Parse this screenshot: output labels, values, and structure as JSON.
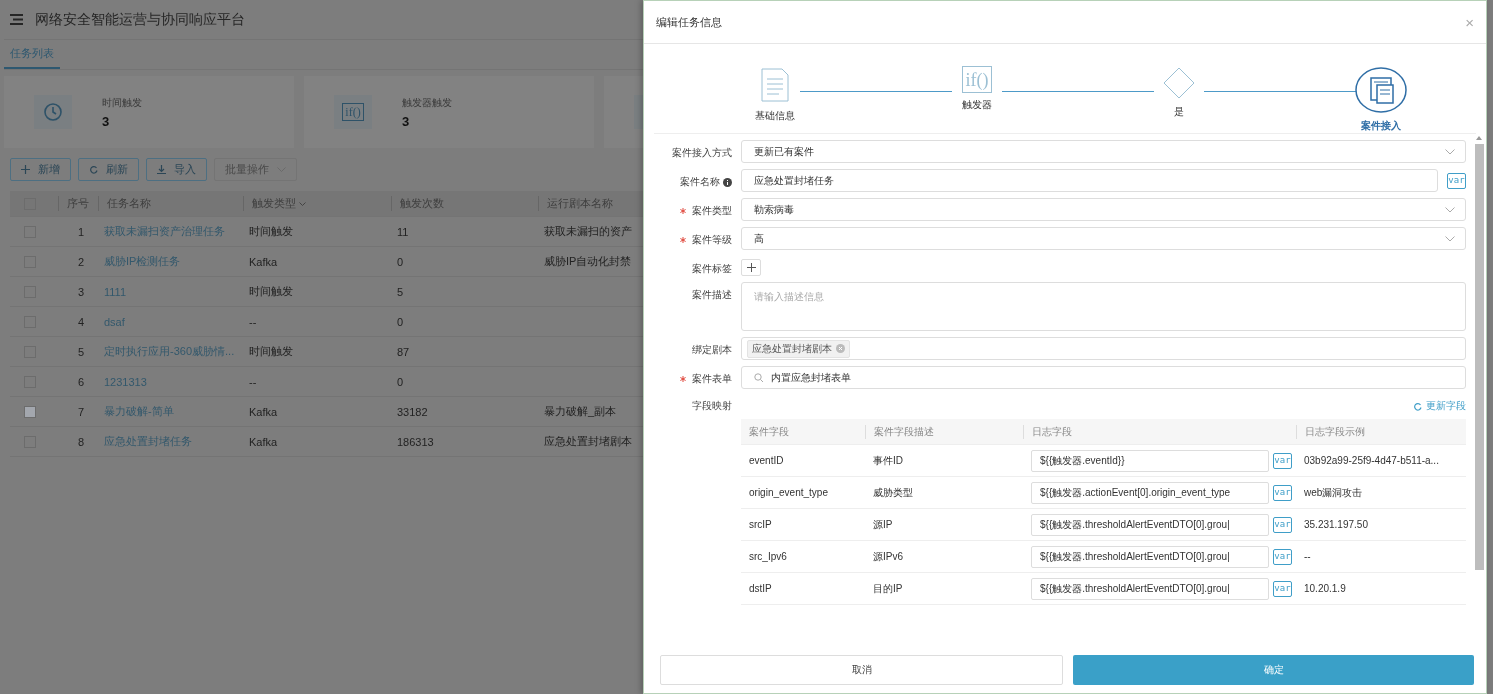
{
  "app": {
    "title": "网络安全智能运营与协同响应平台"
  },
  "tabs": [
    {
      "label": "任务列表",
      "selected": true
    }
  ],
  "stats": [
    {
      "kind": "clock",
      "label": "时间触发",
      "value": "3"
    },
    {
      "kind": "code",
      "icon_text": "if()",
      "label": "触发器触发",
      "value": "3"
    },
    {
      "kind": "partial"
    }
  ],
  "toolbar": [
    {
      "kind": "add",
      "label": "新增",
      "disabled": false
    },
    {
      "kind": "refresh",
      "label": "刷新",
      "disabled": false
    },
    {
      "kind": "import",
      "label": "导入",
      "disabled": false
    },
    {
      "kind": "batch",
      "label": "批量操作",
      "disabled": true
    }
  ],
  "table": {
    "select_all": {
      "checked": false
    },
    "columns": [
      {
        "label": "序号",
        "sortable": false
      },
      {
        "label": "任务名称",
        "sortable": false
      },
      {
        "label": "触发类型",
        "sortable": true
      },
      {
        "label": "触发次数",
        "sortable": false
      },
      {
        "label": "运行剧本名称",
        "sortable": false
      }
    ],
    "rows": [
      {
        "index": "1",
        "name": "获取未漏扫资产治理任务",
        "trigger": "时间触发",
        "count": "11",
        "playbook": "获取未漏扫的资产",
        "disabled": false
      },
      {
        "index": "2",
        "name": "威胁IP检测任务",
        "trigger": "Kafka",
        "count": "0",
        "playbook": "威胁IP自动化封禁",
        "disabled": false
      },
      {
        "index": "3",
        "name": "1111",
        "trigger": "时间触发",
        "count": "5",
        "playbook": "",
        "disabled": false
      },
      {
        "index": "4",
        "name": "dsaf",
        "trigger": "--",
        "count": "0",
        "playbook": "",
        "disabled": false
      },
      {
        "index": "5",
        "name": "定时执行应用-360威胁情...",
        "trigger": "时间触发",
        "count": "87",
        "playbook": "",
        "disabled": false
      },
      {
        "index": "6",
        "name": "1231313",
        "trigger": "--",
        "count": "0",
        "playbook": "",
        "disabled": false
      },
      {
        "index": "7",
        "name": "暴力破解-简单",
        "trigger": "Kafka",
        "count": "33182",
        "playbook": "暴力破解_副本",
        "disabled": true
      },
      {
        "index": "8",
        "name": "应急处置封堵任务",
        "trigger": "Kafka",
        "count": "186313",
        "playbook": "应急处置封堵剧本",
        "disabled": false
      }
    ]
  },
  "drawer": {
    "title": "编辑任务信息",
    "close": "×",
    "steps": [
      {
        "kind": "document",
        "label": "基础信息",
        "selected": false
      },
      {
        "kind": "code",
        "icon_text": "if()",
        "label": "触发器",
        "selected": false
      },
      {
        "kind": "diamond",
        "label": "是",
        "selected": false
      },
      {
        "kind": "case",
        "label": "案件接入",
        "selected": true
      }
    ],
    "form": [
      {
        "kind": "select",
        "label": "案件接入方式",
        "required": false,
        "value": "更新已有案件"
      },
      {
        "kind": "input",
        "label": "案件名称",
        "required": false,
        "info": true,
        "var": "var",
        "value": "应急处置封堵任务"
      },
      {
        "kind": "select",
        "label": "案件类型",
        "required": true,
        "value": "勒索病毒"
      },
      {
        "kind": "select",
        "label": "案件等级",
        "required": true,
        "value": "高"
      },
      {
        "kind": "add",
        "label": "案件标签",
        "required": false
      },
      {
        "kind": "textarea",
        "label": "案件描述",
        "required": false,
        "placeholder": "请输入描述信息"
      },
      {
        "kind": "tags",
        "label": "绑定剧本",
        "required": false,
        "tags": [
          "应急处置封堵剧本"
        ]
      },
      {
        "kind": "search",
        "label": "案件表单",
        "required": true,
        "value": "内置应急封堵表单"
      }
    ],
    "mapping": {
      "label": "字段映射",
      "action": "更新字段",
      "columns": [
        "案件字段",
        "案件字段描述",
        "日志字段",
        "日志字段示例"
      ],
      "rows": [
        {
          "field": "eventID",
          "desc": "事件ID",
          "log": "${{触发器.eventId}}",
          "var": "var",
          "example": "03b92a99-25f9-4d47-b511-a..."
        },
        {
          "field": "origin_event_type",
          "desc": "威胁类型",
          "log": "${{触发器.actionEvent[0].origin_event_type",
          "var": "var",
          "example": "web漏洞攻击"
        },
        {
          "field": "srcIP",
          "desc": "源IP",
          "log": "${{触发器.thresholdAlertEventDTO[0].grou|",
          "var": "var",
          "example": "35.231.197.50"
        },
        {
          "field": "src_Ipv6",
          "desc": "源IPv6",
          "log": "${{触发器.thresholdAlertEventDTO[0].grou|",
          "var": "var",
          "example": "--"
        },
        {
          "field": "dstIP",
          "desc": "目的IP",
          "log": "${{触发器.thresholdAlertEventDTO[0].grou|",
          "var": "var",
          "example": "10.20.1.9"
        }
      ]
    },
    "footer": {
      "cancel": "取消",
      "confirm": "确定"
    }
  }
}
